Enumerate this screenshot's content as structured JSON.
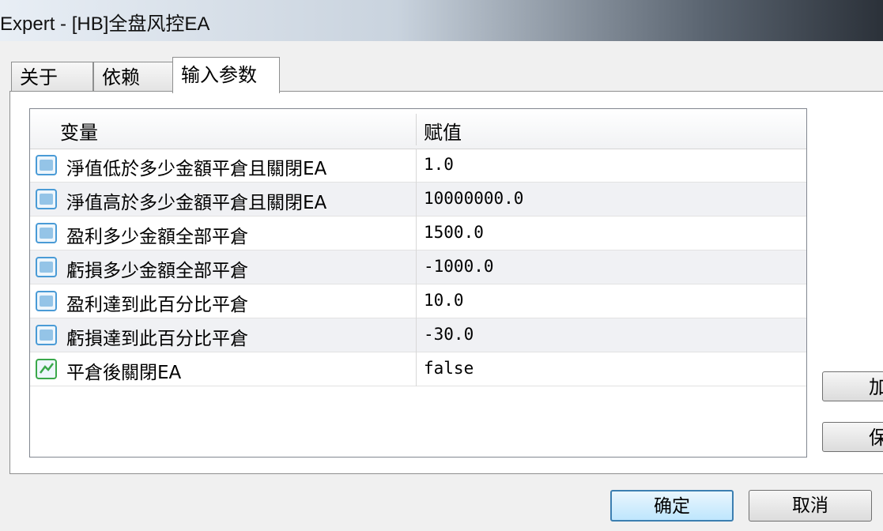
{
  "window": {
    "title": "Expert - [HB]全盘风控EA"
  },
  "tabs": [
    {
      "label": "关于"
    },
    {
      "label": "依赖"
    },
    {
      "label": "输入参数",
      "active": true
    }
  ],
  "table": {
    "columns": [
      "变量",
      "赋值"
    ],
    "rows": [
      {
        "name": "淨值低於多少金額平倉且關閉EA",
        "value": "1.0",
        "icon": "double-param-icon"
      },
      {
        "name": "淨值高於多少金額平倉且關閉EA",
        "value": "10000000.0",
        "icon": "double-param-icon"
      },
      {
        "name": "盈利多少金額全部平倉",
        "value": "1500.0",
        "icon": "double-param-icon"
      },
      {
        "name": "虧損多少金額全部平倉",
        "value": "-1000.0",
        "icon": "double-param-icon"
      },
      {
        "name": "盈利達到此百分比平倉",
        "value": "10.0",
        "icon": "double-param-icon"
      },
      {
        "name": "虧損達到此百分比平倉",
        "value": "-30.0",
        "icon": "double-param-icon"
      },
      {
        "name": "平倉後關閉EA",
        "value": "false",
        "icon": "bool-param-icon"
      }
    ]
  },
  "side_buttons": [
    {
      "label": "加载"
    },
    {
      "label": "保存"
    }
  ],
  "buttons": {
    "ok": "确定",
    "cancel": "取消"
  },
  "colors": {
    "accent": "#3c7fb1",
    "param_icon": "#4a9bd6",
    "bool_icon": "#3aa84a"
  }
}
